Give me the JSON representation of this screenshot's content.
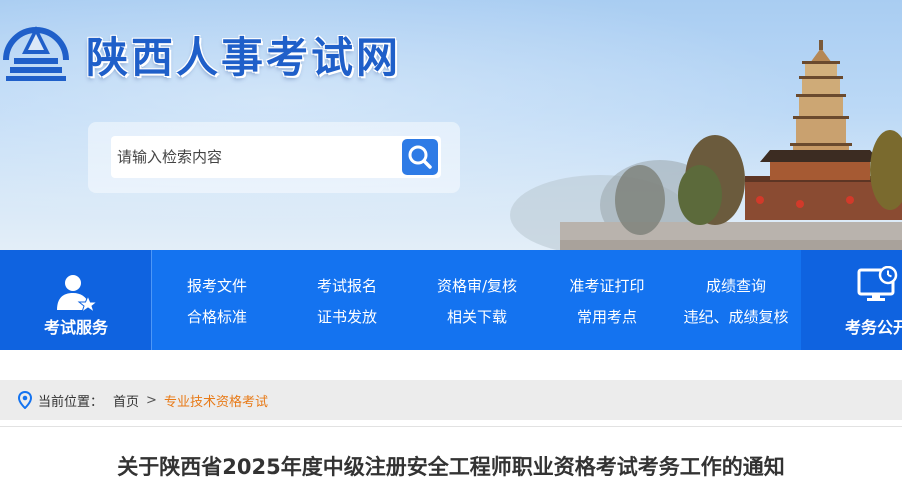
{
  "header": {
    "site_title": "陕西人事考试网"
  },
  "search": {
    "placeholder": "请输入检索内容"
  },
  "nav": {
    "left_label": "考试服务",
    "right_label": "考务公开",
    "row1": [
      "报考文件",
      "考试报名",
      "资格审/复核",
      "准考证打印",
      "成绩查询"
    ],
    "row2": [
      "合格标准",
      "证书发放",
      "相关下载",
      "常用考点",
      "违纪、成绩复核"
    ]
  },
  "breadcrumb": {
    "prefix": "当前位置：",
    "home": "首页",
    "separator": ">",
    "current": "专业技术资格考试"
  },
  "article": {
    "title": "关于陕西省2025年度中级注册安全工程师职业资格考试考务工作的通知"
  },
  "colors": {
    "nav_bar": "#1473f0",
    "nav_side": "#0f63e0",
    "title_blue": "#1f5fc9",
    "breadcrumb_current": "#e87a17"
  }
}
